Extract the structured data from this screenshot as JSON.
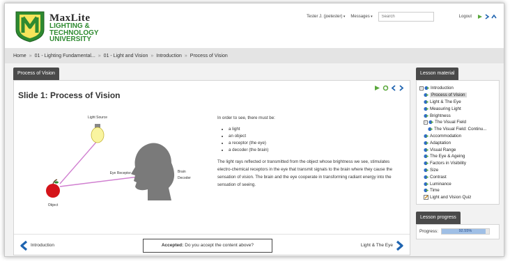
{
  "header": {
    "logo": {
      "line1": "MaxLite",
      "line2": "LIGHTING &",
      "line3": "TECHNOLOGY",
      "line4": "UNIVERSITY"
    },
    "user_menu": "Tester J. (joetester)",
    "messages_menu": "Messages",
    "search_placeholder": "Search",
    "logout": "Logout"
  },
  "breadcrumb": [
    "Home",
    "01 - Lighting Fundamental...",
    "01 - Light and Vision",
    "Introduction",
    "Process of Vision"
  ],
  "breadcrumb_sep": "»",
  "main": {
    "tab_label": "Process of Vision",
    "slide_title": "Slide 1: Process of Vision",
    "diagram": {
      "light_source": "Light Source",
      "eye_receptor": "Eye Receptor",
      "brain_decoder_line1": "Brain",
      "brain_decoder_line2": "Decoder",
      "object": "Object"
    },
    "intro": "In order to see, there must be:",
    "bullets": [
      "a light",
      "an object",
      "a receptor (the eye)",
      "a decoder (the brain)"
    ],
    "paragraph": "The light rays reflected or transmitted from the object whose brightness we see, stimulates electro-chemical receptors in the eye that transmit signals to the brain where they cause the sensation of vision. The brain and the eye cooperate in transforming radiant energy into the sensation of seeing.",
    "prev_label": "Introduction",
    "next_label": "Light & The Eye",
    "accept_bold": "Accepted:",
    "accept_text": "Do you accept the content above?"
  },
  "sidebar": {
    "material_tab": "Lesson material",
    "tree": [
      {
        "label": "Introduction",
        "level": 0,
        "expander": "−",
        "selected": false
      },
      {
        "label": "Process of Vision",
        "level": 1,
        "selected": true
      },
      {
        "label": "Light & The Eye",
        "level": 1,
        "selected": false
      },
      {
        "label": "Measuring Light",
        "level": 1,
        "selected": false
      },
      {
        "label": "Brightness",
        "level": 1,
        "selected": false
      },
      {
        "label": "The Visual Field",
        "level": 1,
        "expander": "−",
        "selected": false
      },
      {
        "label": "The Visual Field: Continu...",
        "level": 2,
        "selected": false
      },
      {
        "label": "Accommodation",
        "level": 1,
        "selected": false
      },
      {
        "label": "Adaptation",
        "level": 1,
        "selected": false
      },
      {
        "label": "Visual Range",
        "level": 1,
        "selected": false
      },
      {
        "label": "The Eye & Ageing",
        "level": 1,
        "selected": false
      },
      {
        "label": "Factors in Visibility",
        "level": 1,
        "selected": false
      },
      {
        "label": "Size",
        "level": 1,
        "selected": false
      },
      {
        "label": "Contrast",
        "level": 1,
        "selected": false
      },
      {
        "label": "Luminance",
        "level": 1,
        "selected": false
      },
      {
        "label": "Time",
        "level": 1,
        "selected": false
      },
      {
        "label": "Light and Vision Quiz",
        "level": 1,
        "selected": false,
        "quiz": true
      }
    ],
    "progress_tab": "Lesson progress",
    "progress_label": "Progress:",
    "progress_value": "92.55%",
    "progress_fraction": 0.9255
  },
  "colors": {
    "brand_green": "#2e8a30",
    "link_blue": "#1f64b0",
    "tab_dark": "#4a4a4a"
  }
}
